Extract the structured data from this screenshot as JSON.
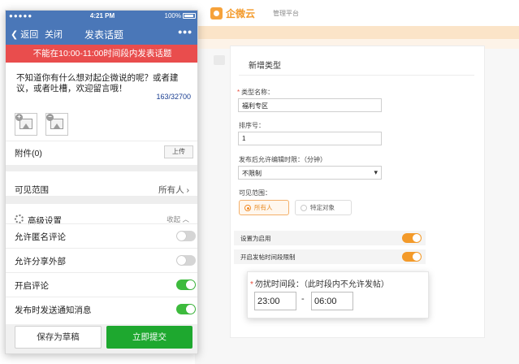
{
  "admin": {
    "brand": "企微云",
    "brand_sub": "管理平台",
    "panel_title": "新增类型",
    "type_name_label": "类型名称：",
    "type_name_value": "福利专区",
    "sort_label": "排序号：",
    "sort_value": "1",
    "edit_limit_label": "发布后允许编辑时限：（分钟）",
    "edit_limit_value": "不限制",
    "visible_label": "可见范围：",
    "visible_options": [
      "所有人",
      "特定对象"
    ],
    "visible_selected": "所有人",
    "enable_label": "设置为启用",
    "enable_on": true,
    "time_limit_label": "开启发帖时间段限制",
    "time_limit_on": true,
    "dnd_label": "勿扰时间段：（此时段内不允许发帖）",
    "dnd_start": "23:00",
    "dnd_sep": "-",
    "dnd_end": "06:00",
    "accent_color": "#f39a2a"
  },
  "phone": {
    "status": {
      "signal": "●●●●● ",
      "time": "4:21 PM",
      "battery": "100%"
    },
    "nav": {
      "back": "返回",
      "close": "关闭",
      "title": "发表话题",
      "more": "•••"
    },
    "warning": "不能在10:00-11:00时间段内发表话题",
    "topic_placeholder": "不知道你有什么想对起企微说的呢？或者建议，或者吐槽，欢迎留言哦！",
    "char_count": "163/32700",
    "attachment_label": "附件(0)",
    "upload_label": "上传",
    "visible_label": "可见范围",
    "visible_value": "所有人",
    "advanced_label": "高级设置",
    "collapse_label": "收起",
    "settings": [
      {
        "label": "允许匿名评论",
        "on": false
      },
      {
        "label": "允许分享外部",
        "on": false
      },
      {
        "label": "开启评论",
        "on": true
      },
      {
        "label": "发布时发送通知消息",
        "on": true
      }
    ],
    "save_draft": "保存为草稿",
    "submit": "立即提交",
    "nav_color": "#4a77b8",
    "warning_color": "#e94d4d",
    "submit_color": "#1ea82f"
  }
}
